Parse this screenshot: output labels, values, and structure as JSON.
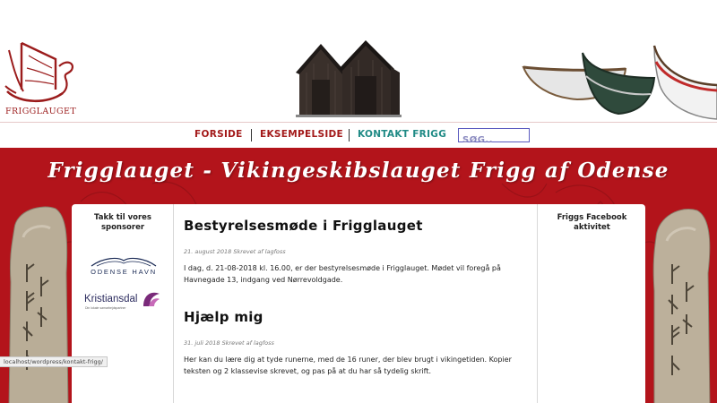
{
  "header": {
    "logo_text": "FRIGGLAUGET"
  },
  "nav": {
    "items": [
      {
        "label": "FORSIDE"
      },
      {
        "label": "EKSEMPELSIDE"
      },
      {
        "label": "KONTAKT FRIGG"
      }
    ],
    "search_placeholder": "SØG.."
  },
  "banner": {
    "title": "Frigglauget - Vikingeskibslauget Frigg af Odense"
  },
  "sidebar_left": {
    "title": "Takk til vores sponsorer",
    "sponsors": [
      {
        "name": "ODENSE HAVN"
      },
      {
        "name": "Kristiansdal",
        "tagline": "Din lokale samarbejdspartner"
      }
    ]
  },
  "posts": [
    {
      "title": "Bestyrelsesmøde i Frigglauget",
      "meta": "21. august 2018 Skrevet af lagfoss",
      "body": "I dag, d. 21-08-2018 kl. 16.00, er der bestyrelsesmøde i Frigglauget. Mødet vil foregå på Havnegade 13, indgang ved Nørrevoldgade."
    },
    {
      "title": "Hjælp mig",
      "meta": "31. juli 2018 Skrevet af lagfoss",
      "body": "Her kan du lære dig at tyde runerne, med de 16 runer, der blev brugt i vikingetiden. Kopier teksten og 2 klassevise skrevet, og pas på at du har så tydelig skrift."
    }
  ],
  "sidebar_right": {
    "title": "Friggs Facebook aktivitet"
  },
  "status_bar": {
    "url": "localhost/wordpress/kontakt-frigg/"
  },
  "colors": {
    "brand_red": "#b3141b",
    "nav_red": "#a31a1a",
    "nav_teal": "#1f8a85",
    "search_border": "#5a5abf"
  }
}
